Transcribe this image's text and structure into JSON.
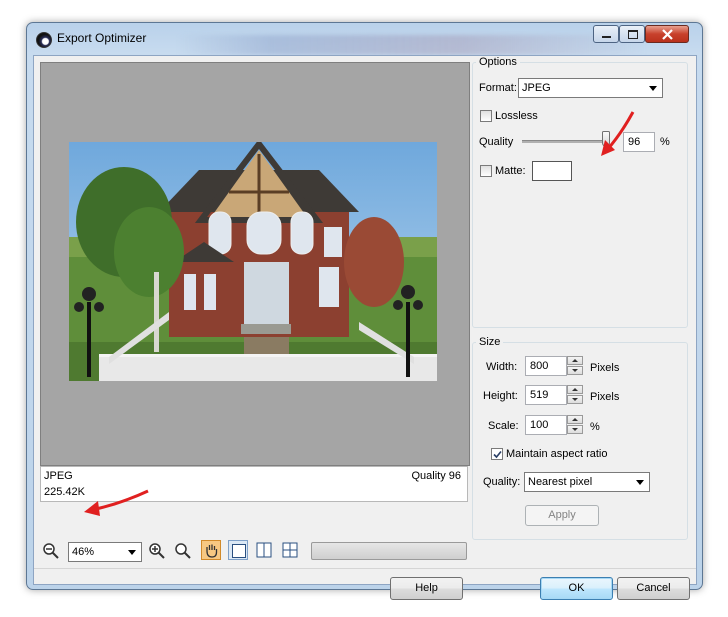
{
  "window": {
    "title": "Export Optimizer"
  },
  "preview": {
    "format_label": "JPEG",
    "file_size": "225.42K",
    "quality_label": "Quality 96"
  },
  "toolbar": {
    "zoom_value": "46%"
  },
  "options": {
    "group_label": "Options",
    "format_label": "Format:",
    "format_value": "JPEG",
    "lossless_label": "Lossless",
    "lossless_checked": false,
    "quality_label": "Quality",
    "quality_value": "96",
    "quality_unit": "%",
    "quality_level": 0.96,
    "matte_label": "Matte:",
    "matte_checked": false,
    "matte_color": "#ffffff"
  },
  "size": {
    "group_label": "Size",
    "width_label": "Width:",
    "width_value": "800",
    "width_unit": "Pixels",
    "height_label": "Height:",
    "height_value": "519",
    "height_unit": "Pixels",
    "scale_label": "Scale:",
    "scale_value": "100",
    "scale_unit": "%",
    "aspect_label": "Maintain aspect ratio",
    "aspect_checked": true,
    "quality_label": "Quality:",
    "quality_value": "Nearest pixel",
    "apply_label": "Apply"
  },
  "buttons": {
    "help": "Help",
    "ok": "OK",
    "cancel": "Cancel"
  },
  "colors": {
    "annotation_arrow": "#e02020",
    "default_button_border": "#3c7fb1",
    "pan_tool_active": "#f7c882"
  },
  "icons": [
    "app-icon",
    "minimize-icon",
    "maximize-icon",
    "close-icon",
    "zoom-out-icon",
    "zoom-in-icon",
    "zoom-fit-icon",
    "pan-hand-icon",
    "single-view-icon",
    "split-view-icon",
    "quad-view-icon"
  ]
}
